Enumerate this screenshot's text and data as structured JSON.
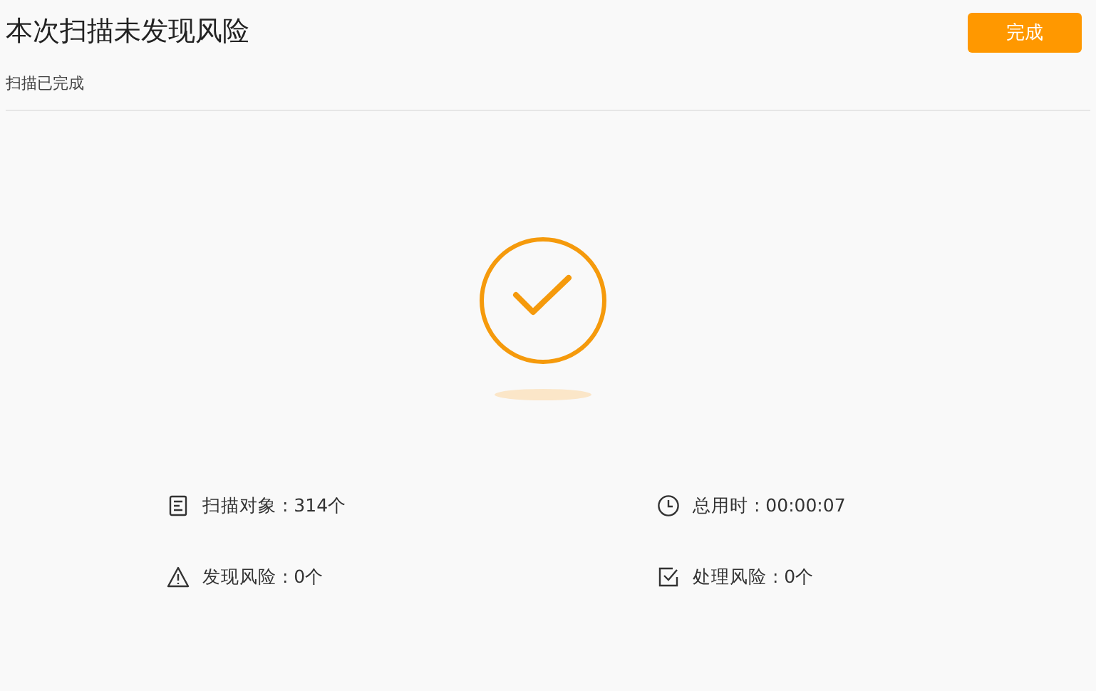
{
  "header": {
    "title": "本次扫描未发现风险",
    "subtitle": "扫描已完成",
    "done_button": "完成"
  },
  "stats": [
    {
      "kind": "document",
      "label": "扫描对象 : 314个"
    },
    {
      "kind": "clock",
      "label": "总用时 : 00:00:07"
    },
    {
      "kind": "warning",
      "label": "发现风险 : 0个"
    },
    {
      "kind": "checkbox",
      "label": "处理风险 : 0个"
    }
  ]
}
